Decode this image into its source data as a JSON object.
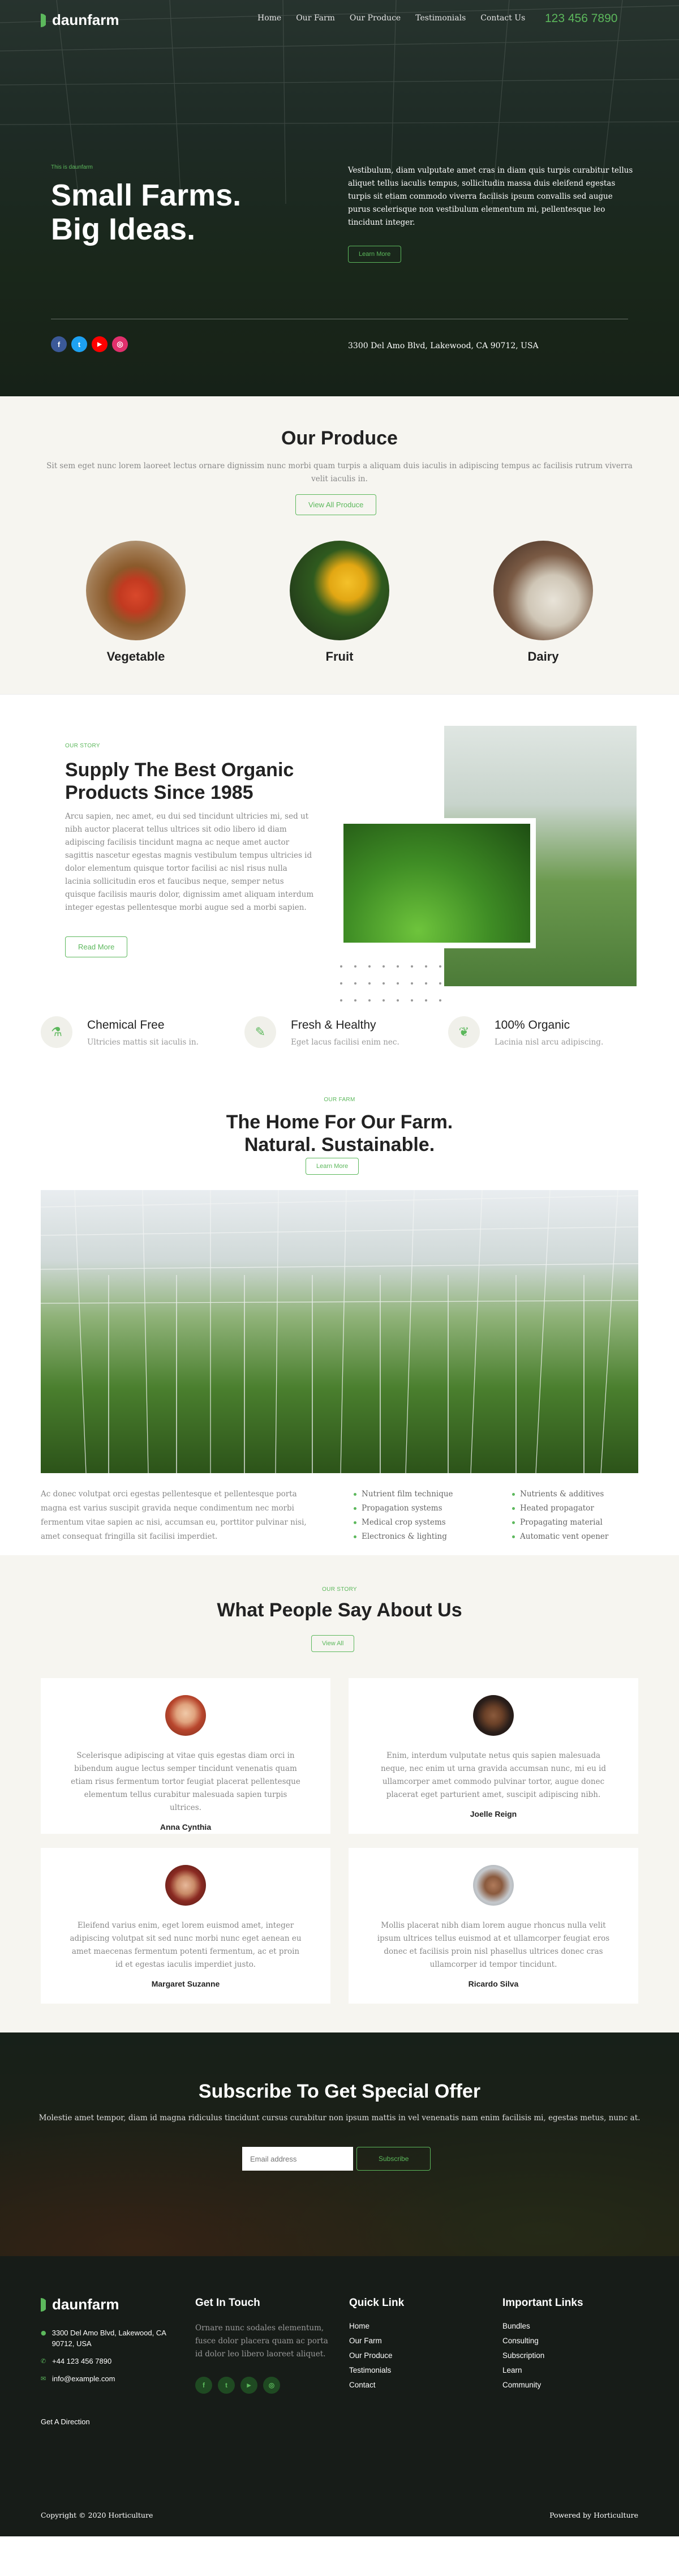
{
  "nav": {
    "logo": "daunfarm",
    "links": [
      "Home",
      "Our Farm",
      "Our Produce",
      "Testimonials",
      "Contact Us"
    ],
    "phone": "123 456 7890"
  },
  "hero": {
    "tag": "This is daunfarm",
    "title_line1": "Small Farms.",
    "title_line2": "Big Ideas.",
    "desc": "Vestibulum, diam vulputate amet cras in diam quis turpis curabitur tellus aliquet tellus iaculis tempus, sollicitudin massa duis eleifend egestas turpis sit etiam commodo viverra facilisis ipsum convallis sed augue purus scelerisque non vestibulum elementum mi, pellentesque leo tincidunt integer.",
    "button": "Learn More",
    "social": [
      "f",
      "t",
      "▶",
      "◎"
    ],
    "social_colors": [
      "#3b5998",
      "#1da1f2",
      "#ff0000",
      "#e1306c"
    ],
    "address": "3300 Del Amo Blvd, Lakewood, CA 90712, USA"
  },
  "produce": {
    "title": "Our Produce",
    "desc": "Sit sem eget nunc lorem laoreet lectus ornare dignissim nunc morbi quam turpis a aliquam duis iaculis in adipiscing tempus ac facilisis rutrum viverra velit iaculis in.",
    "button": "View All Produce",
    "items": [
      "Vegetable",
      "Fruit",
      "Dairy"
    ]
  },
  "story": {
    "tag": "OUR STORY",
    "title": "Supply The Best Organic Products Since 1985",
    "text": "Arcu sapien, nec amet, eu dui sed tincidunt ultricies mi, sed ut nibh auctor placerat tellus ultrices sit odio libero id diam adipiscing facilisis tincidunt magna ac neque amet auctor sagittis nascetur egestas magnis vestibulum tempus ultricies id dolor elementum quisque tortor facilisi ac nisl risus nulla lacinia sollicitudin eros et faucibus neque, semper netus quisque facilisis mauris dolor, dignissim amet aliquam interdum integer egestas pellentesque morbi augue sed a morbi sapien.",
    "button": "Read More",
    "features": [
      {
        "title": "Chemical Free",
        "desc": "Ultricies mattis sit iaculis in.",
        "icon": "⚗"
      },
      {
        "title": "Fresh & Healthy",
        "desc": "Eget lacus facilisi enim nec.",
        "icon": "✎"
      },
      {
        "title": "100% Organic",
        "desc": "Lacinia nisl arcu adipiscing.",
        "icon": "❦"
      }
    ]
  },
  "home": {
    "tag": "OUR FARM",
    "title_line1": "The Home For Our Farm.",
    "title_line2": "Natural. Sustainable.",
    "button": "Learn More",
    "body": "Ac donec volutpat orci egestas pellentesque et pellentesque porta magna est varius suscipit gravida neque condimentum nec morbi fermentum vitae sapien ac nisi, accumsan eu, porttitor pulvinar nisi, amet consequat fringilla sit facilisi imperdiet.",
    "list1": [
      "Nutrient film technique",
      "Propagation systems",
      "Medical crop systems",
      "Electronics & lighting"
    ],
    "list2": [
      "Nutrients & additives",
      "Heated propagator",
      "Propagating material",
      "Automatic vent opener"
    ]
  },
  "testimonials": {
    "tag": "OUR STORY",
    "title": "What People Say About Us",
    "button": "View All",
    "items": [
      {
        "quote": "Scelerisque adipiscing at vitae quis egestas diam orci in bibendum augue lectus semper tincidunt venenatis quam etiam risus fermentum tortor feugiat placerat pellentesque elementum tellus curabitur malesuada sapien turpis ultrices.",
        "name": "Anna Cynthia"
      },
      {
        "quote": "Enim, interdum vulputate netus quis sapien malesuada neque, nec enim ut urna gravida accumsan nunc, mi eu id ullamcorper amet commodo pulvinar tortor, augue donec placerat eget parturient amet, suscipit adipiscing nibh.",
        "name": "Joelle Reign"
      },
      {
        "quote": "Eleifend varius enim, eget lorem euismod amet, integer adipiscing volutpat sit sed nunc morbi nunc eget aenean eu amet maecenas fermentum potenti fermentum, ac et proin id et egestas iaculis imperdiet justo.",
        "name": "Margaret Suzanne"
      },
      {
        "quote": "Mollis placerat nibh diam lorem augue rhoncus nulla velit ipsum ultrices tellus euismod at et ullamcorper feugiat eros donec et facilisis proin nisl phasellus ultrices donec cras ullamcorper id tempor tincidunt.",
        "name": "Ricardo Silva"
      }
    ]
  },
  "subscribe": {
    "title": "Subscribe To Get Special Offer",
    "desc": "Molestie amet tempor, diam id magna ridiculus tincidunt cursus curabitur non ipsum mattis in vel venenatis nam enim facilisis mi, egestas metus, nunc at.",
    "placeholder": "Email address",
    "button": "Subscribe"
  },
  "footer": {
    "logo": "daunfarm",
    "address": "3300 Del Amo Blvd, Lakewood, CA 90712, USA",
    "phone": "+44 123 456 7890",
    "email": "info@example.com",
    "direction": "Get A Direction",
    "touch_title": "Get In Touch",
    "touch_text": "Ornare nunc sodales elementum, fusce dolor placera quam ac porta id dolor leo libero laoreet aliquet.",
    "touch_social": [
      "f",
      "t",
      "▶",
      "◎"
    ],
    "quick_title": "Quick Link",
    "quick_links": [
      "Home",
      "Our Farm",
      "Our Produce",
      "Testimonials",
      "Contact"
    ],
    "important_title": "Important Links",
    "important_links": [
      "Bundles",
      "Consulting",
      "Subscription",
      "Learn",
      "Community"
    ],
    "copyright": "Copyright © 2020 Horticulture",
    "powered": "Powered by Horticulture"
  },
  "colors": {
    "accent": "#5cb85c",
    "dark": "#171c18",
    "light_bg": "#f6f5f0"
  }
}
